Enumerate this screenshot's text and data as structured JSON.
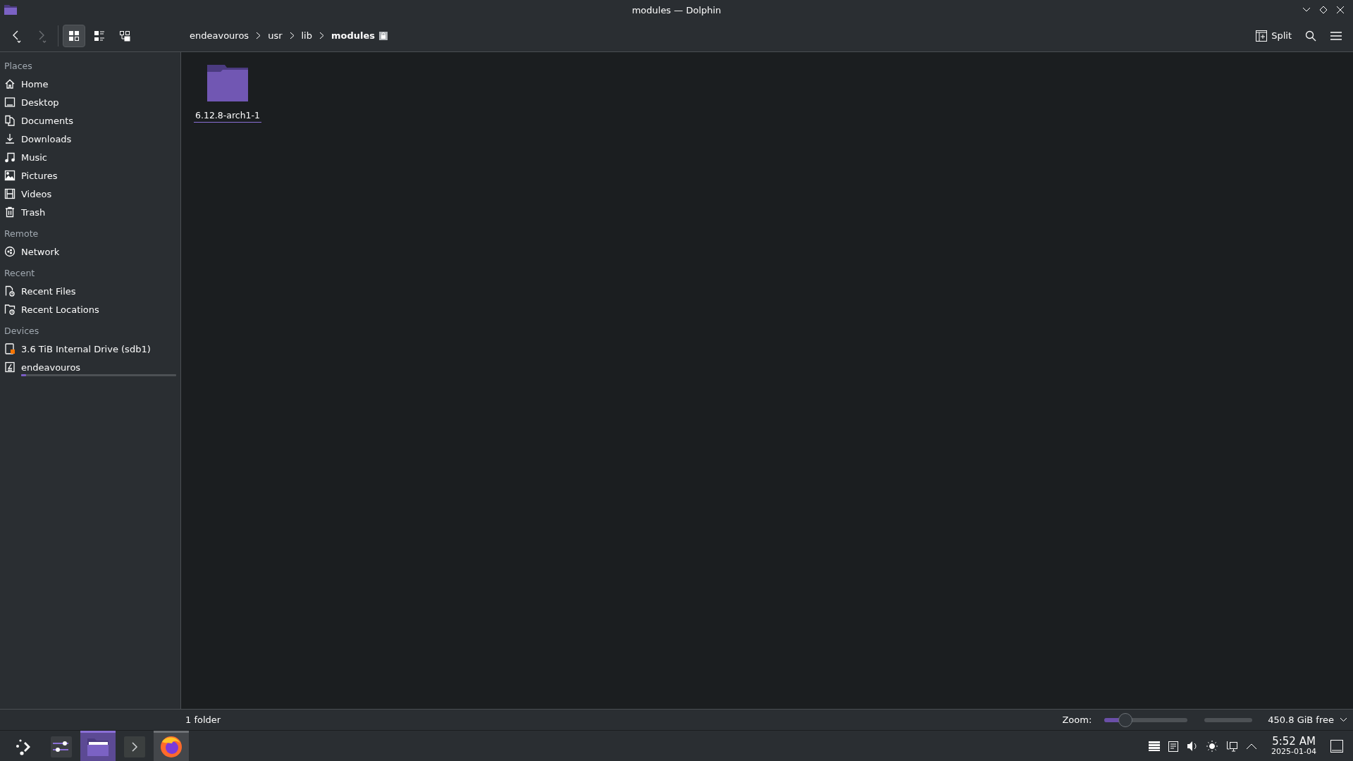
{
  "window": {
    "title": "modules — Dolphin"
  },
  "toolbar": {
    "view_modes": [
      {
        "kind": "icons",
        "selected": true
      },
      {
        "kind": "details",
        "selected": false
      },
      {
        "kind": "tree",
        "selected": false
      }
    ],
    "breadcrumb": [
      {
        "label": "endeavouros",
        "current": false
      },
      {
        "label": "usr",
        "current": false
      },
      {
        "label": "lib",
        "current": false
      },
      {
        "label": "modules",
        "current": true
      }
    ],
    "split_label": "Split"
  },
  "sidebar": {
    "sections": [
      {
        "title": "Places",
        "items": [
          {
            "label": "Home"
          },
          {
            "label": "Desktop"
          },
          {
            "label": "Documents"
          },
          {
            "label": "Downloads"
          },
          {
            "label": "Music"
          },
          {
            "label": "Pictures"
          },
          {
            "label": "Videos"
          },
          {
            "label": "Trash"
          }
        ]
      },
      {
        "title": "Remote",
        "items": [
          {
            "label": "Network"
          }
        ]
      },
      {
        "title": "Recent",
        "items": [
          {
            "label": "Recent Files"
          },
          {
            "label": "Recent Locations"
          }
        ]
      },
      {
        "title": "Devices",
        "items": [
          {
            "label": "3.6 TiB Internal Drive (sdb1)"
          },
          {
            "label": "endeavouros",
            "level": 0.03
          }
        ]
      }
    ]
  },
  "files": [
    {
      "name": "6.12.8-arch1-1",
      "kind": "folder"
    }
  ],
  "status_bar": {
    "summary": "1 folder",
    "zoom_label": "Zoom:",
    "zoom": {
      "level": 0.25
    },
    "free_space": "450.8 GiB free"
  },
  "taskbar": {
    "apps": [
      {
        "kind": "launcher",
        "active": false,
        "hovered": false
      },
      {
        "kind": "settings",
        "active": false,
        "hovered": false
      },
      {
        "kind": "files",
        "active": true,
        "hovered": false
      },
      {
        "kind": "terminal",
        "active": false,
        "hovered": false
      },
      {
        "kind": "browser",
        "active": false,
        "hovered": true
      }
    ],
    "clock": {
      "time": "5:52 AM",
      "date": "2025-01-04"
    }
  }
}
